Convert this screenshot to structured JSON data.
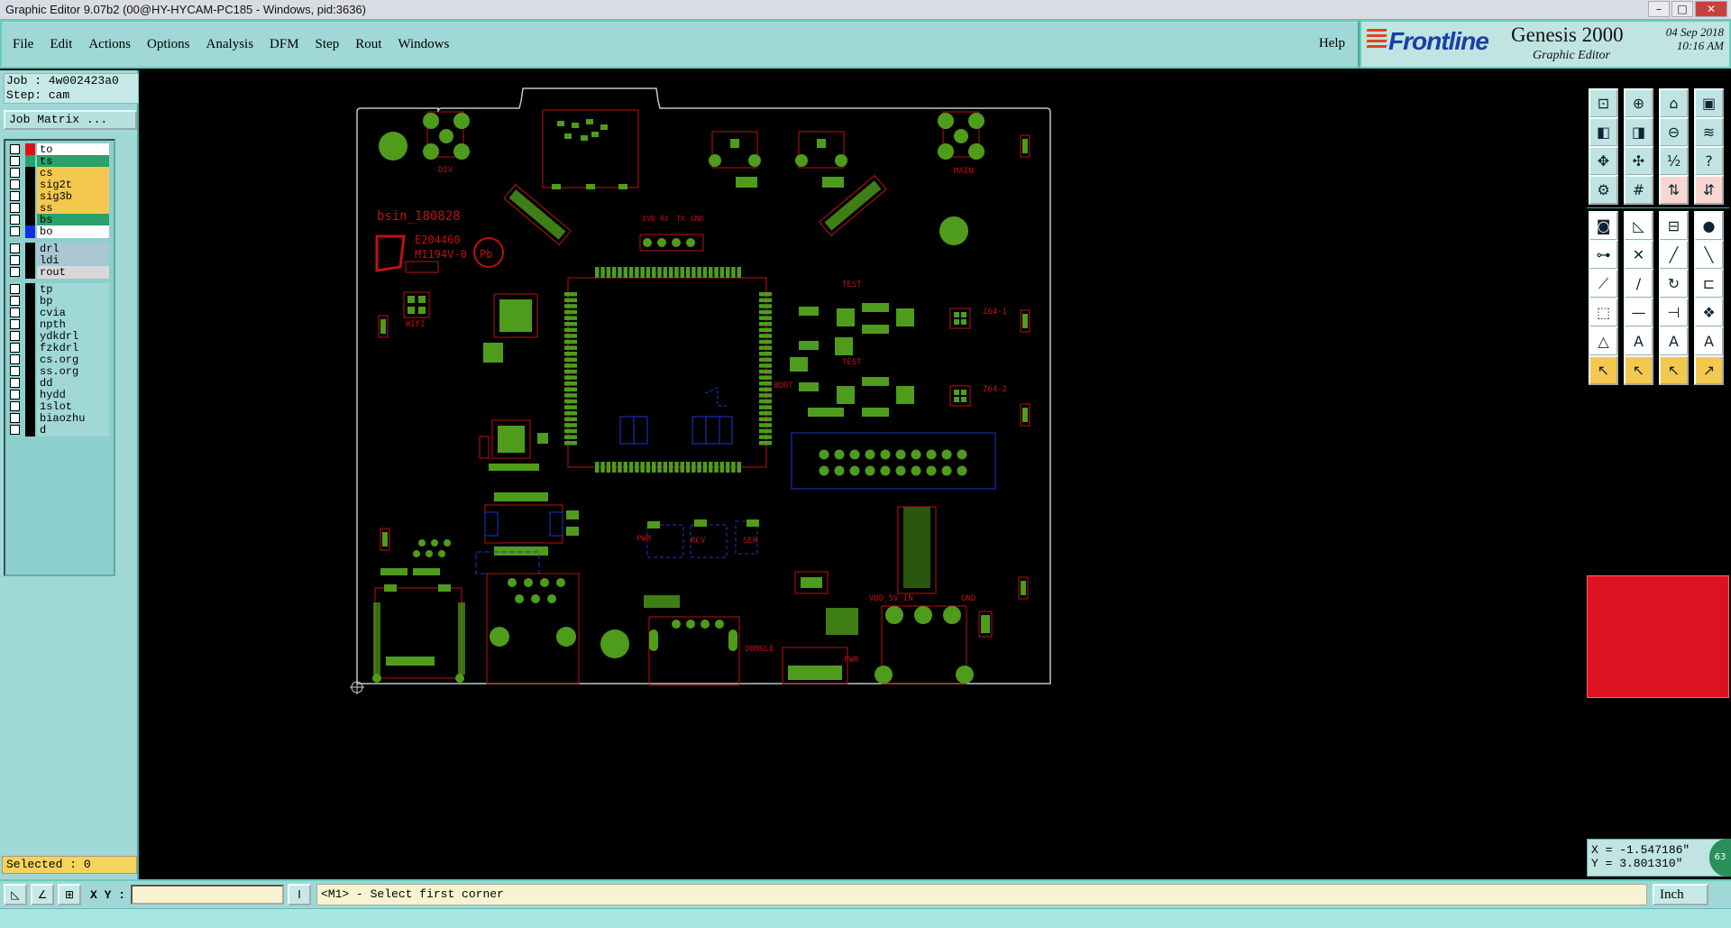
{
  "window": {
    "title": "Graphic Editor 9.07b2 (00@HY-HYCAM-PC185 - Windows, pid:3636)"
  },
  "menu": {
    "items": [
      "File",
      "Edit",
      "Actions",
      "Options",
      "Analysis",
      "DFM",
      "Step",
      "Rout",
      "Windows"
    ],
    "help": "Help"
  },
  "brand": {
    "logo": "Frontline",
    "product": "Genesis 2000",
    "subtitle": "Graphic Editor",
    "date": "04 Sep 2018",
    "time": "10:16 AM"
  },
  "job": {
    "job_line": "Job : 4w002423a0",
    "step_line": "Step: cam",
    "matrix_button": "Job Matrix ..."
  },
  "layers": [
    {
      "name": "to",
      "bg": "#ffffff",
      "swatch": "#e01010"
    },
    {
      "name": "ts",
      "bg": "#2aa06a",
      "swatch": "#2aa06a"
    },
    {
      "name": "cs",
      "bg": "#f4c84e",
      "swatch": "#000000"
    },
    {
      "name": "sig2t",
      "bg": "#f4c84e",
      "swatch": "#000000"
    },
    {
      "name": "sig3b",
      "bg": "#f4c84e",
      "swatch": "#000000"
    },
    {
      "name": "ss",
      "bg": "#f4c84e",
      "swatch": "#000000"
    },
    {
      "name": "bs",
      "bg": "#2aa06a",
      "swatch": "#000000"
    },
    {
      "name": "bo",
      "bg": "#ffffff",
      "swatch": "#1030e0"
    },
    {
      "name": "drl",
      "bg": "#a9c7d0",
      "swatch": "#000000"
    },
    {
      "name": "ldi",
      "bg": "#a9c7d0",
      "swatch": "#000000"
    },
    {
      "name": "rout",
      "bg": "#d8d8d8",
      "swatch": "#000000"
    },
    {
      "name": "tp",
      "bg": "#9fd8d6",
      "swatch": "#000000"
    },
    {
      "name": "bp",
      "bg": "#9fd8d6",
      "swatch": "#000000"
    },
    {
      "name": "cvia",
      "bg": "#9fd8d6",
      "swatch": "#000000"
    },
    {
      "name": "npth",
      "bg": "#9fd8d6",
      "swatch": "#000000"
    },
    {
      "name": "ydkdrl",
      "bg": "#9fd8d6",
      "swatch": "#000000"
    },
    {
      "name": "fzkdrl",
      "bg": "#9fd8d6",
      "swatch": "#000000"
    },
    {
      "name": "cs.org",
      "bg": "#9fd8d6",
      "swatch": "#000000"
    },
    {
      "name": "ss.org",
      "bg": "#9fd8d6",
      "swatch": "#000000"
    },
    {
      "name": "dd",
      "bg": "#9fd8d6",
      "swatch": "#000000"
    },
    {
      "name": "hydd",
      "bg": "#9fd8d6",
      "swatch": "#000000"
    },
    {
      "name": "1slot",
      "bg": "#9fd8d6",
      "swatch": "#000000"
    },
    {
      "name": "biaozhu",
      "bg": "#9fd8d6",
      "swatch": "#000000"
    },
    {
      "name": "d",
      "bg": "#9fd8d6",
      "swatch": "#000000"
    }
  ],
  "selected": "Selected : 0",
  "board": {
    "labels": [
      "DIV",
      "MAIN",
      "bsin_180828",
      "E204460",
      "M1194V-0",
      "WIFI",
      "TEST",
      "TEST",
      "BOOT",
      "Z64-1",
      "Z64-2",
      "PWR",
      "RCV",
      "SER",
      "DONGLE",
      "PWR",
      "VDD_5V_IN",
      "GND",
      "1V8",
      "RX",
      "TX",
      "GND",
      "Pb"
    ]
  },
  "coords": {
    "x": "X = -1.547186\"",
    "y": "Y = 3.801310\""
  },
  "status": {
    "xy_label": "X Y :",
    "xy_value": "",
    "prompt": "<M1> - Select first corner",
    "unit": "Inch",
    "badge": "63"
  },
  "icons": [
    "zoom-home-icon",
    "zoom-in-icon",
    "zoom-out-icon",
    "grid-icon",
    "snap-icon",
    "measure-icon",
    "select-icon"
  ]
}
